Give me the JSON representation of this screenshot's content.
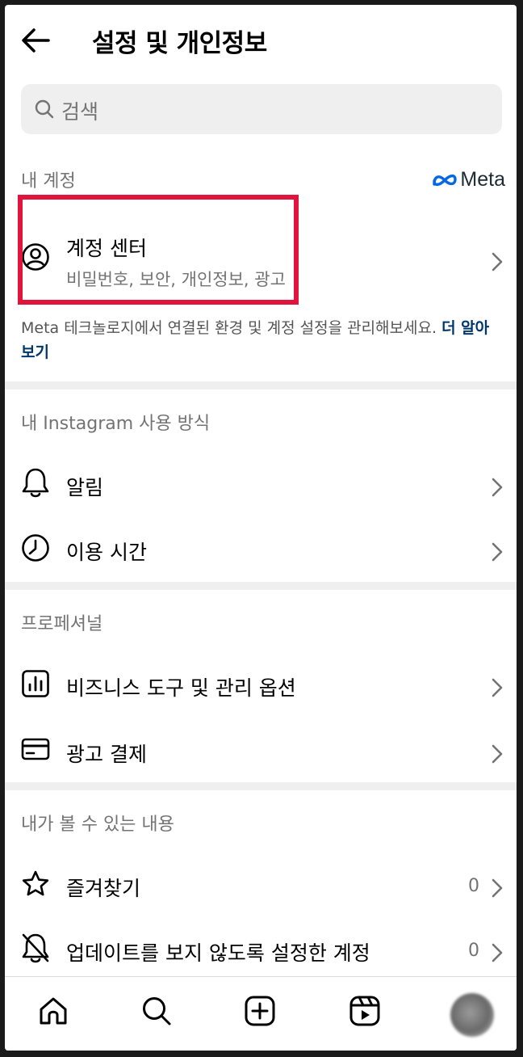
{
  "header": {
    "title": "설정 및 개인정보"
  },
  "search": {
    "placeholder": "검색"
  },
  "my_account": {
    "label": "내 계정",
    "brand": "Meta",
    "account_center": {
      "title": "계정 센터",
      "subtitle": "비밀번호, 보안, 개인정보, 광고"
    },
    "description": "Meta 테크놀로지에서 연결된 환경 및 계정 설정을 관리해보세요.",
    "learn_more": "더 알아보기"
  },
  "usage": {
    "label": "내 Instagram 사용 방식",
    "items": [
      {
        "title": "알림"
      },
      {
        "title": "이용 시간"
      }
    ]
  },
  "professional": {
    "label": "프로페셔널",
    "items": [
      {
        "title": "비즈니스 도구 및 관리 옵션"
      },
      {
        "title": "광고 결제"
      }
    ]
  },
  "content": {
    "label": "내가 볼 수 있는 내용",
    "items": [
      {
        "title": "즐겨찾기",
        "count": "0"
      },
      {
        "title": "업데이트를 보지 않도록 설정한 계정",
        "count": "0"
      }
    ]
  },
  "colors": {
    "accent_link": "#00376b",
    "highlight": "#e0143c",
    "meta_blue": "#0668e1"
  }
}
